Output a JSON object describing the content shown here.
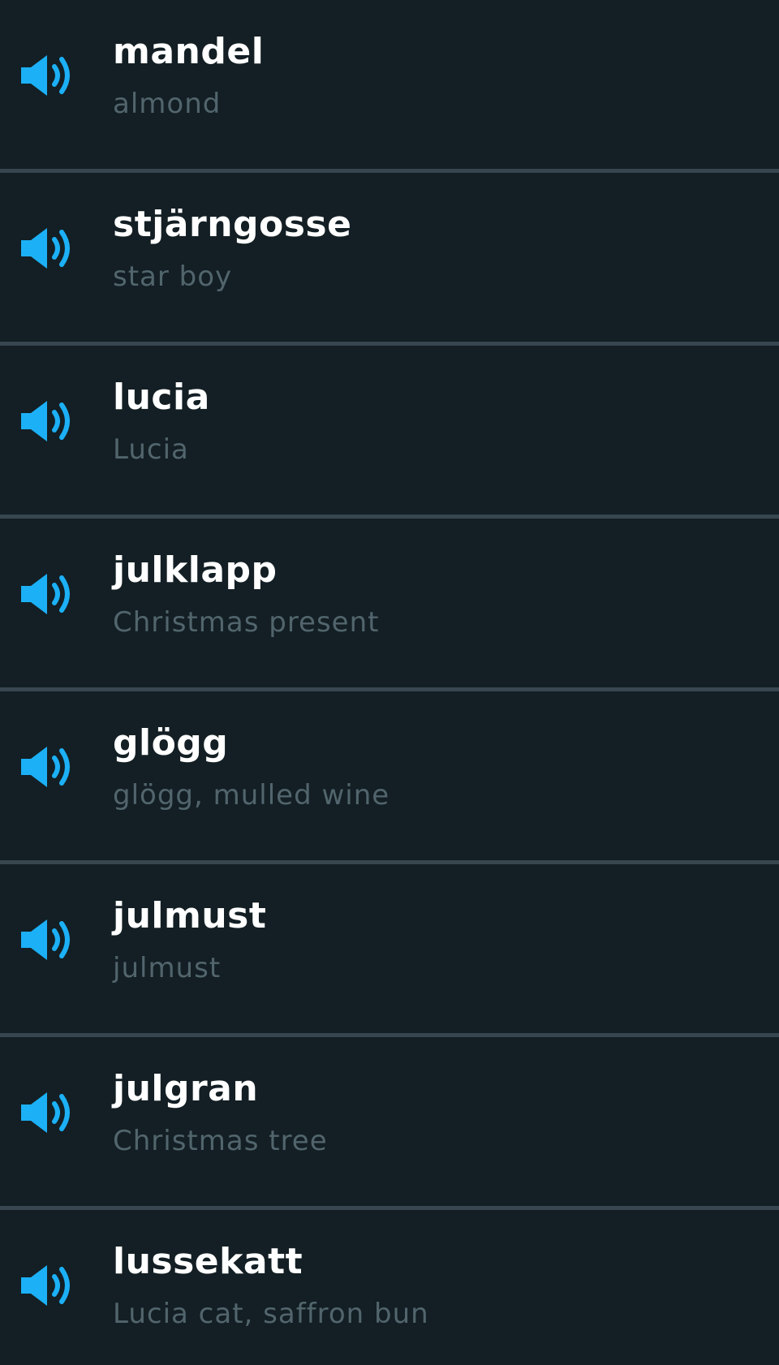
{
  "colors": {
    "background": "#131F24",
    "divider": "#37464F",
    "word": "#FFFFFF",
    "translation": "#52656D",
    "speaker": "#1CB0F6"
  },
  "words": [
    {
      "icon": "speaker-icon",
      "word": "mandel",
      "translation": "almond"
    },
    {
      "icon": "speaker-icon",
      "word": "stjärngosse",
      "translation": "star boy"
    },
    {
      "icon": "speaker-icon",
      "word": "lucia",
      "translation": "Lucia"
    },
    {
      "icon": "speaker-icon",
      "word": "julklapp",
      "translation": "Christmas present"
    },
    {
      "icon": "speaker-icon",
      "word": "glögg",
      "translation": "glögg, mulled wine"
    },
    {
      "icon": "speaker-icon",
      "word": "julmust",
      "translation": "julmust"
    },
    {
      "icon": "speaker-icon",
      "word": "julgran",
      "translation": "Christmas tree"
    },
    {
      "icon": "speaker-icon",
      "word": "lussekatt",
      "translation": "Lucia cat, saffron bun"
    }
  ]
}
